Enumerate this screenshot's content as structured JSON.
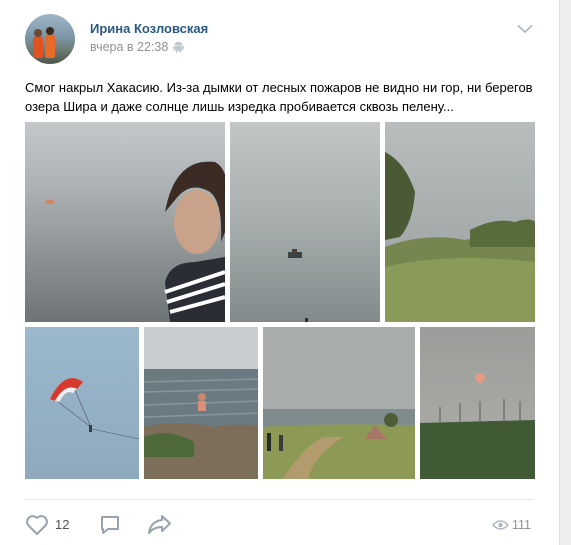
{
  "post": {
    "author": "Ирина Козловская",
    "time": "вчера в 22:38",
    "text": "Смог накрыл Хакасию. Из-за дымки от лесных пожаров не видно ни гор, ни берегов озера Шира и даже солнце лишь изредка пробивается сквозь пелену...",
    "photos": [
      {
        "subject": "woman by hazy lake"
      },
      {
        "subject": "boat on hazy lake"
      },
      {
        "subject": "lake shore with tree and grass"
      },
      {
        "subject": "parasailing parachute in sky"
      },
      {
        "subject": "woman swimming near shore"
      },
      {
        "subject": "beach campsite on lake"
      },
      {
        "subject": "sun through smoke over field"
      }
    ]
  },
  "actions": {
    "likes": "12",
    "views": "111"
  },
  "icons": {
    "menu": "chevron-down-icon",
    "device": "android-icon",
    "like": "heart-icon",
    "comment": "comment-icon",
    "share": "share-icon",
    "views": "eye-icon"
  },
  "colors": {
    "link": "#2a5885",
    "muted": "#939393",
    "icon": "#99a2ad"
  }
}
